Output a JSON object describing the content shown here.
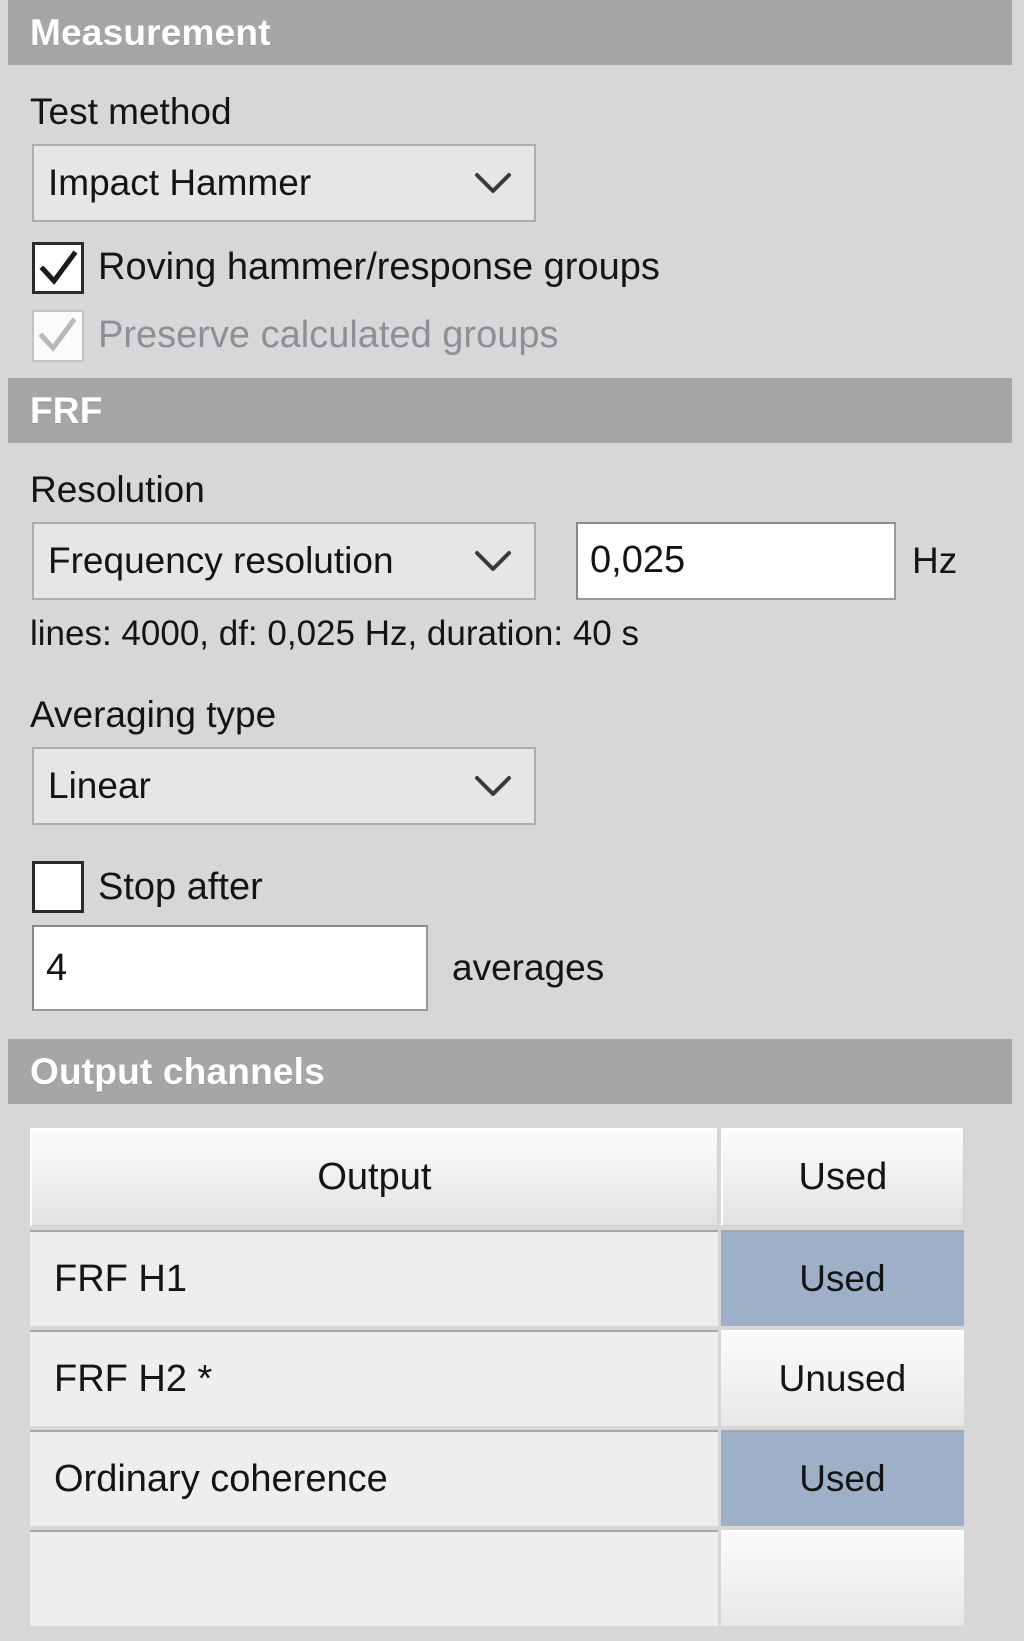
{
  "sections": {
    "measurement": {
      "title": "Measurement"
    },
    "frf": {
      "title": "FRF"
    },
    "output_channels": {
      "title": "Output channels"
    }
  },
  "measurement": {
    "test_method_label": "Test method",
    "test_method_value": "Impact Hammer",
    "roving_checkbox_label": "Roving hammer/response groups",
    "preserve_checkbox_label": "Preserve calculated groups"
  },
  "frf": {
    "resolution_label": "Resolution",
    "resolution_mode_value": "Frequency resolution",
    "resolution_value": "0,025",
    "resolution_unit": "Hz",
    "resolution_helper": "lines: 4000, df: 0,025 Hz, duration: 40 s",
    "averaging_type_label": "Averaging type",
    "averaging_type_value": "Linear",
    "stop_after_label": "Stop after",
    "stop_after_value": "4",
    "stop_after_unit": "averages"
  },
  "table": {
    "columns": [
      "Output",
      "Used"
    ],
    "rows": [
      {
        "output": "FRF H1",
        "used": "Used"
      },
      {
        "output": "FRF H2 *",
        "used": "Unused"
      },
      {
        "output": "Ordinary coherence",
        "used": "Used"
      }
    ]
  },
  "colors": {
    "section_header_bg": "#a6a6a6",
    "panel_bg": "#d7d7da",
    "used_badge_bg": "#9db0c8"
  }
}
